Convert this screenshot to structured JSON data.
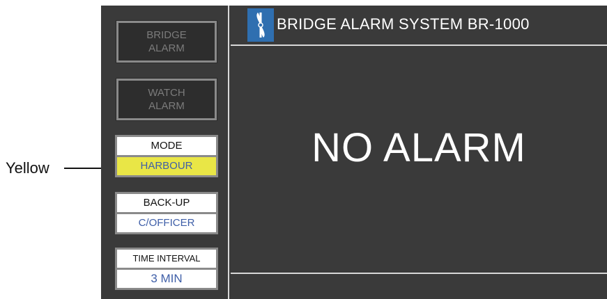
{
  "annotation": {
    "label": "Yellow"
  },
  "sidebar": {
    "bridge_alarm": {
      "line1": "BRIDGE",
      "line2": "ALARM"
    },
    "watch_alarm": {
      "line1": "WATCH",
      "line2": "ALARM"
    },
    "mode": {
      "label": "MODE",
      "value": "HARBOUR"
    },
    "backup": {
      "label": "BACK-UP",
      "value": "C/OFFICER"
    },
    "time_interval": {
      "label": "TIME INTERVAL",
      "value": "3 MIN"
    }
  },
  "header": {
    "title": "BRIDGE ALARM SYSTEM BR-1000",
    "logo_icon": "propeller-logo-icon"
  },
  "main": {
    "status": "NO ALARM"
  },
  "colors": {
    "panel_bg": "#3a3a3a",
    "mode_highlight": "#e9e646",
    "value_text": "#3f5fa8",
    "logo_bg": "#2f6fb0"
  }
}
